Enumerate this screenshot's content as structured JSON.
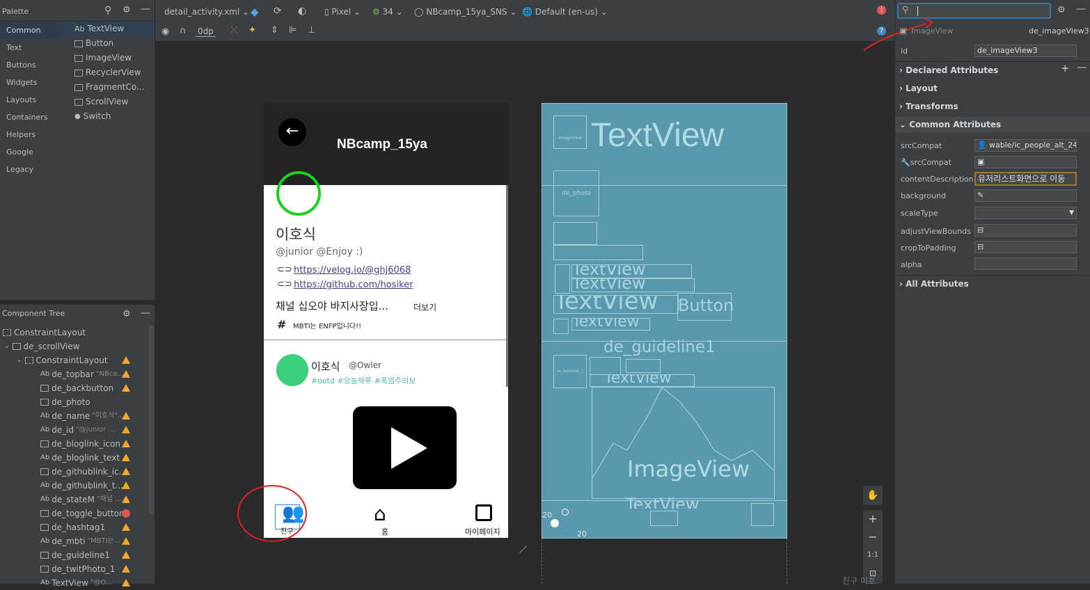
{
  "palette": {
    "title": "Palette",
    "categories": [
      "Common",
      "Text",
      "Buttons",
      "Widgets",
      "Layouts",
      "Containers",
      "Helpers",
      "Google",
      "Legacy"
    ],
    "widgets": [
      {
        "icon": "Ab",
        "label": "TextView"
      },
      {
        "icon": "▭",
        "label": "Button"
      },
      {
        "icon": "▣",
        "label": "ImageView"
      },
      {
        "icon": "☰",
        "label": "RecyclerView"
      },
      {
        "icon": "▤",
        "label": "FragmentCo..."
      },
      {
        "icon": "▥",
        "label": "ScrollView"
      },
      {
        "icon": "●",
        "label": "Switch"
      }
    ]
  },
  "tree": {
    "title": "Component Tree",
    "rows": [
      {
        "label": "ConstraintLayout",
        "sub": "",
        "status": ""
      },
      {
        "label": "de_scrollView",
        "sub": "",
        "status": ""
      },
      {
        "label": "ConstraintLayout",
        "sub": "",
        "status": "warn"
      },
      {
        "label": "de_topbar",
        "sub": "\"NBca...",
        "status": "warn"
      },
      {
        "label": "de_backbutton",
        "sub": "",
        "status": "warn"
      },
      {
        "label": "de_photo",
        "sub": "",
        "status": ""
      },
      {
        "label": "de_name",
        "sub": "\"이호식\"...",
        "status": "warn"
      },
      {
        "label": "de_id",
        "sub": "\"@junior ...",
        "status": "warn"
      },
      {
        "label": "de_bloglink_icon",
        "sub": "",
        "status": "warn"
      },
      {
        "label": "de_bloglink_text",
        "sub": "...",
        "status": "warn"
      },
      {
        "label": "de_githublink_ic...",
        "sub": "",
        "status": "warn"
      },
      {
        "label": "de_githublink_t...",
        "sub": "",
        "status": "warn"
      },
      {
        "label": "de_stateM",
        "sub": "\"채널 ...",
        "status": "warn"
      },
      {
        "label": "de_toggle_button",
        "sub": "",
        "status": "error"
      },
      {
        "label": "de_hashtag1",
        "sub": "",
        "status": "warn"
      },
      {
        "label": "de_mbti",
        "sub": "\"MBTI는...",
        "status": "warn"
      },
      {
        "label": "de_guideline1",
        "sub": "",
        "status": "warn"
      },
      {
        "label": "de_twitPhoto_1",
        "sub": "",
        "status": "warn"
      },
      {
        "label": "TextView",
        "sub": "\"@O...",
        "status": "warn"
      }
    ]
  },
  "toolbar": {
    "file": "detail_activity.xml",
    "device": "Pixel",
    "api": "34",
    "theme": "NBcamp_15ya_SNS",
    "locale": "Default (en-us)",
    "margin": "0dp"
  },
  "phone": {
    "title": "NBcamp_15ya",
    "name": "이호식",
    "id": "@junior @Enjoy :)",
    "blog": "https://velog.io/@ghj6068",
    "github": "https://github.com/hosiker",
    "state": "채널 십오야 바지사장입...",
    "more": "더보기",
    "mbti": "MBTI는 ENFP입니다!!",
    "post_name": "이호식",
    "post_id": "@Owler",
    "tags": "#ootd #오늘하루 #폭염주의보",
    "nav_home": "홈",
    "nav_my": "마이페이지",
    "nav_friends": "친구"
  },
  "blueprint": {
    "tv_big": "TextView",
    "photo": "de_photo",
    "tv1": "TextView",
    "tv2": "TextView",
    "tv3": "TextView",
    "btn": "Button",
    "tv4": "TextView",
    "guide": "de_guideline1",
    "tv5": "TextView",
    "img": "ImageView",
    "tv6": "TextView",
    "small_img": "ImageView",
    "twit": "de_twitPhoto_1",
    "n20a": "20",
    "n20b": "20"
  },
  "props": {
    "search": "",
    "type": "ImageView",
    "name": "de_imageView3",
    "id_label": "id",
    "id": "de_imageView3",
    "sections": [
      "Declared Attributes",
      "Layout",
      "Transforms",
      "Common Attributes",
      "All Attributes"
    ],
    "attrs": [
      {
        "k": "srcCompat",
        "v": "wable/ic_people_alt_24"
      },
      {
        "k": "srcCompat",
        "v": ""
      },
      {
        "k": "contentDescription",
        "v": "유저리스트화면으로 이동"
      },
      {
        "k": "background",
        "v": ""
      },
      {
        "k": "scaleType",
        "v": ""
      },
      {
        "k": "adjustViewBounds",
        "v": ""
      },
      {
        "k": "cropToPadding",
        "v": ""
      },
      {
        "k": "alpha",
        "v": ""
      }
    ]
  },
  "zoom": {
    "fit": "1:1"
  },
  "bottom_text": "친구 이호"
}
